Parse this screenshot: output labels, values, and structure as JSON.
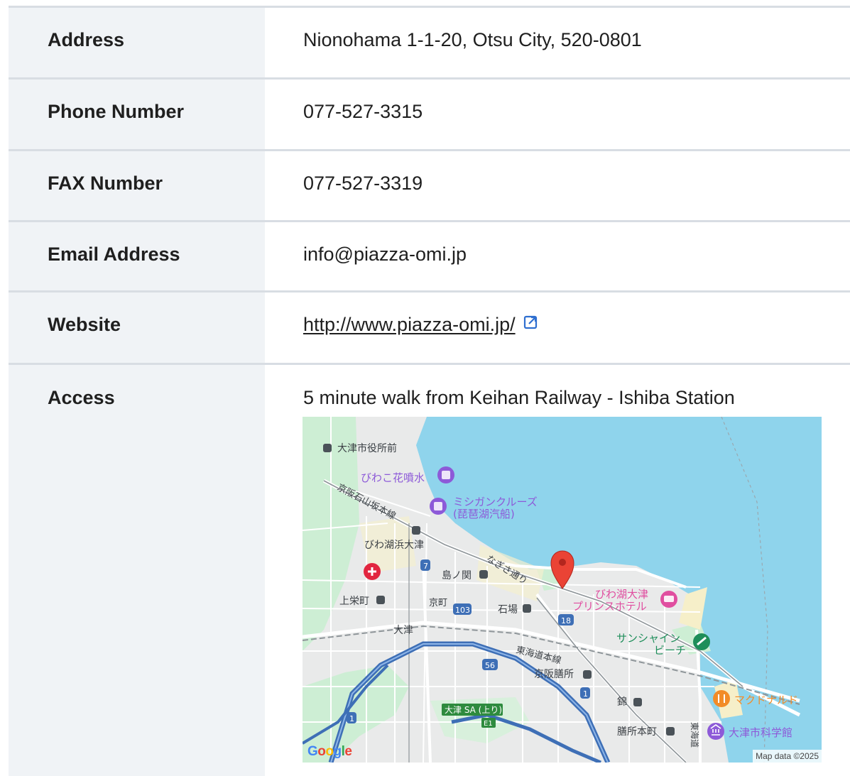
{
  "rows": {
    "address": {
      "label": "Address",
      "value": "Nionohama 1-1-20, Otsu City, 520-0801"
    },
    "phone": {
      "label": "Phone Number",
      "value": "077-527-3315"
    },
    "fax": {
      "label": "FAX Number",
      "value": "077-527-3319"
    },
    "email": {
      "label": "Email Address",
      "value": "info@piazza-omi.jp"
    },
    "website": {
      "label": "Website",
      "value": "http://www.piazza-omi.jp/"
    },
    "access": {
      "label": "Access",
      "value": "5 minute walk from Keihan Railway - Ishiba Station"
    }
  },
  "map": {
    "labels": {
      "otsu_city_hall": "大津市役所前",
      "biwako_fountain": "びわこ花噴水",
      "michigan_cruise_1": "ミシガンクルーズ",
      "michigan_cruise_2": "(琵琶湖汽船)",
      "keihan_line": "京阪石山坂本線",
      "biwakohama_otsu": "びわ湖浜大津",
      "shimanoseki": "島ノ関",
      "nagisa_dori": "なぎさ通り",
      "hotel_1": "びわ湖大津",
      "hotel_2": "プリンスホテル",
      "kamisakaemachi": "上栄町",
      "kyomachi": "京町",
      "ishiba": "石場",
      "otsu": "大津",
      "sunshine_beach_1": "サンシャイン",
      "sunshine_beach_2": "ビーチ",
      "tokaido_line": "東海道本線",
      "keihan_zeze": "京阪膳所",
      "zeze": "錦",
      "mcdonalds": "マクドナルド",
      "otsu_sa": "大津 SA (上り)",
      "zeze_honmachi": "膳所本町",
      "science_museum": "大津市科学館",
      "tokaido": "東海道",
      "r7": "7",
      "r103": "103",
      "r18": "18",
      "r56": "56",
      "r1a": "1",
      "r1b": "1",
      "e1": "E1"
    },
    "google_logo": {
      "g1": "G",
      "o1": "o",
      "o2": "o",
      "g2": "g",
      "l": "l",
      "e": "e"
    },
    "attribution": "Map data ©2025",
    "colors": {
      "water": "#8fd4ec",
      "land": "#e9eaea",
      "park": "#c9ecd0",
      "highway": "#3e6fb6",
      "pin": "#ea4335",
      "poi_purple": "#8d5ad8",
      "poi_pink": "#e04ea0",
      "poi_green": "#1e8e5a",
      "poi_orange": "#f28c28"
    }
  }
}
